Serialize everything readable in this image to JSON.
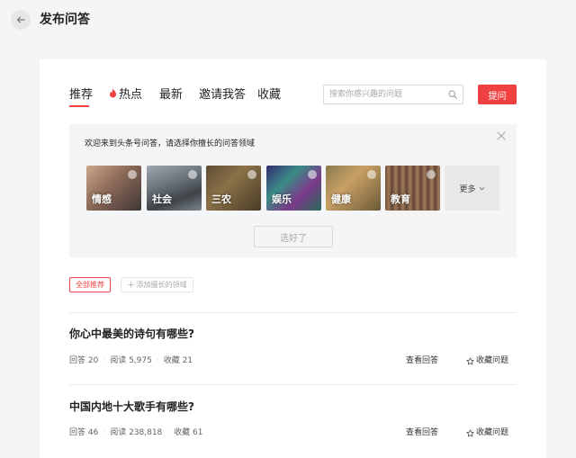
{
  "header": {
    "title": "发布问答"
  },
  "tabs": [
    {
      "label": "推荐",
      "active": true
    },
    {
      "label": "热点",
      "icon": "fire-icon"
    },
    {
      "label": "最新"
    },
    {
      "label": "邀请我答"
    },
    {
      "label": "收藏"
    }
  ],
  "search": {
    "placeholder": "搜索你感兴趣的问题"
  },
  "ask_button": "提问",
  "welcome": {
    "text": "欢迎来到头条号问答，请选择你擅长的问答领域",
    "topics": [
      {
        "label": "情感"
      },
      {
        "label": "社会"
      },
      {
        "label": "三农"
      },
      {
        "label": "娱乐"
      },
      {
        "label": "健康"
      },
      {
        "label": "教育"
      }
    ],
    "more_label": "更多",
    "confirm_label": "选好了"
  },
  "filters": {
    "all_label": "全部推荐",
    "add_label": "添加擅长的领域"
  },
  "questions": [
    {
      "title": "你心中最美的诗句有哪些?",
      "answers": "回答 20",
      "reads": "阅读 5,975",
      "favorites": "收藏 21",
      "view_label": "查看回答",
      "fav_label": "收藏问题"
    },
    {
      "title": "中国内地十大歌手有哪些?",
      "answers": "回答 46",
      "reads": "阅读 238,818",
      "favorites": "收藏 61",
      "view_label": "查看回答",
      "fav_label": "收藏问题"
    }
  ],
  "colors": {
    "accent": "#f04142",
    "page_bg": "#f4f5f6",
    "card_bg": "#ffffff"
  }
}
